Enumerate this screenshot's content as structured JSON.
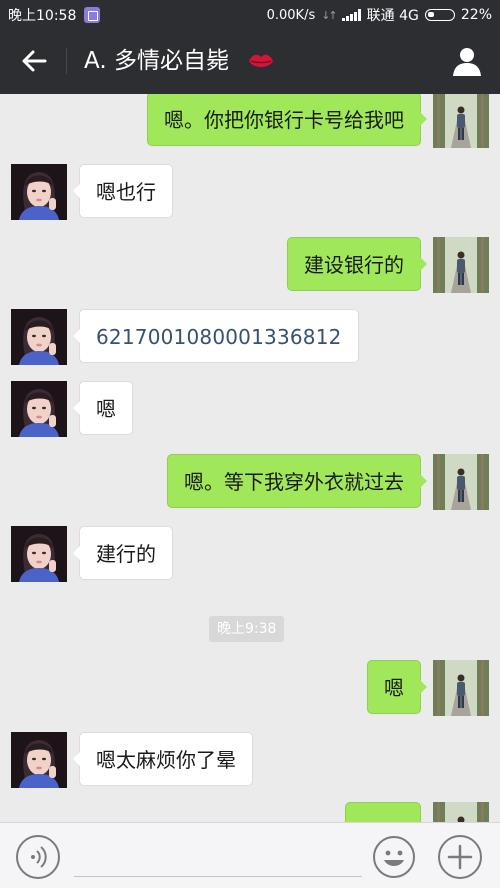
{
  "status_bar": {
    "time": "晚上10:58",
    "network_speed": "0.00K/s",
    "carrier": "联通 4G",
    "battery": "22%"
  },
  "header": {
    "title": "A.  多情必自毙",
    "icons": {
      "back": "back-arrow-icon",
      "title_emoji": "lips-icon",
      "profile": "person-icon"
    }
  },
  "messages": [
    {
      "side": "right",
      "text": "嗯。你把你银行卡号给我吧"
    },
    {
      "side": "left",
      "text": "嗯也行"
    },
    {
      "side": "right",
      "text": "建设银行的"
    },
    {
      "side": "left",
      "text": "6217001080001336812"
    },
    {
      "side": "left",
      "text": "嗯"
    },
    {
      "side": "right",
      "text": "嗯。等下我穿外衣就过去"
    },
    {
      "side": "left",
      "text": "建行的"
    },
    {
      "timestamp": "晚上9:38"
    },
    {
      "side": "right",
      "text": "嗯"
    },
    {
      "side": "left",
      "text": "嗯太麻烦你了晕"
    },
    {
      "side": "right",
      "text": ""
    }
  ],
  "input_bar": {
    "text_value": "",
    "icons": {
      "voice": "voice-icon",
      "emoji": "emoji-icon",
      "more": "plus-icon"
    }
  },
  "colors": {
    "header_bg": "#2d2e32",
    "chat_bg": "#ebebeb",
    "bubble_sent": "#a0e75a",
    "bubble_received": "#ffffff",
    "number_link": "#3a4f74"
  }
}
